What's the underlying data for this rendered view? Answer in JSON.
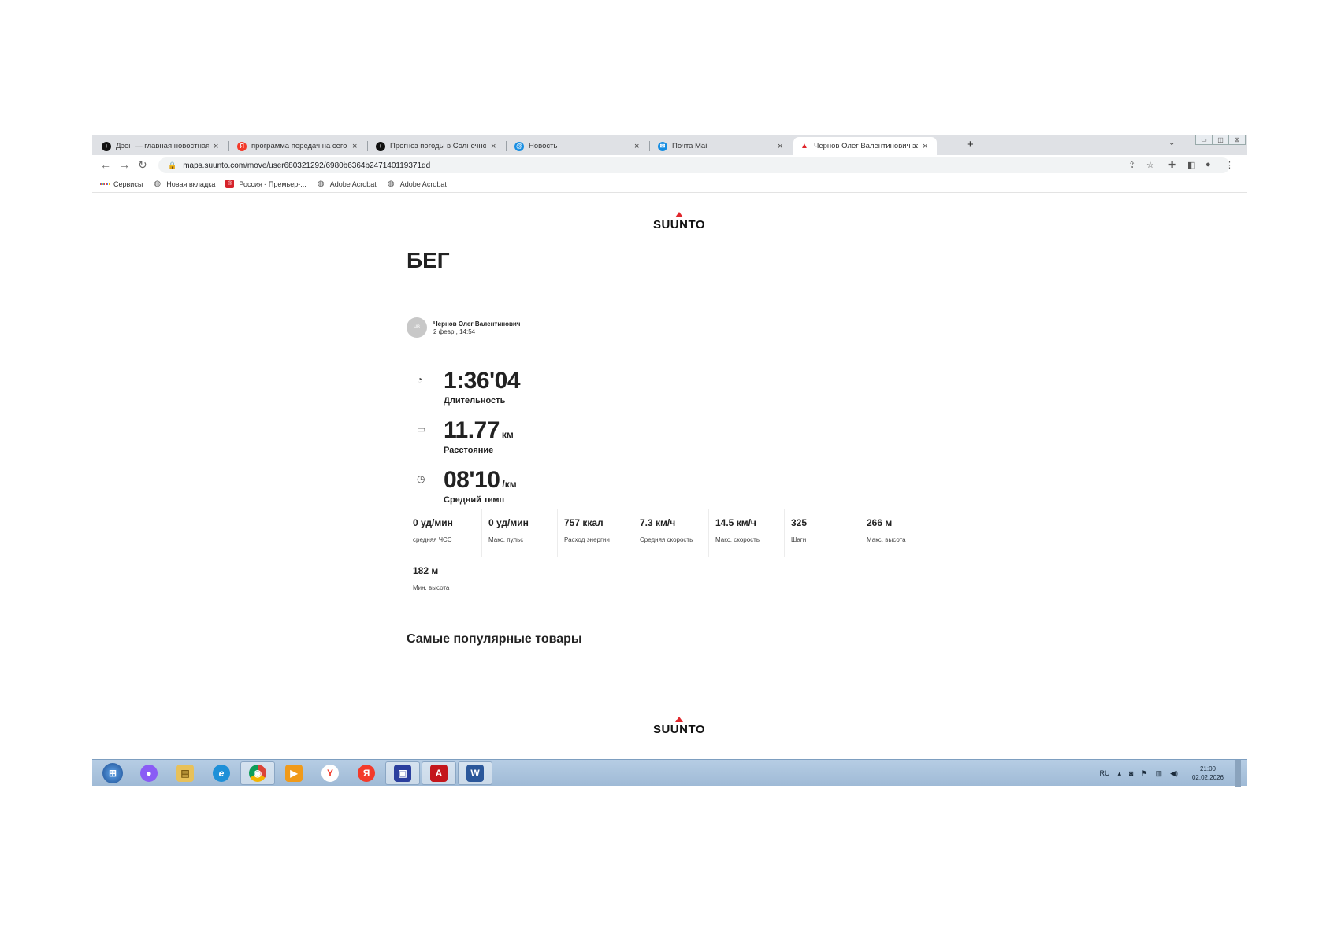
{
  "browser": {
    "tabs": [
      {
        "title": "Дзен — главная новостная инф",
        "favicon": "dzen-icon",
        "color": "#111111",
        "glyph": "+"
      },
      {
        "title": "программа передач на сегодня",
        "favicon": "yandex-icon",
        "color": "#f33a2a",
        "glyph": "Я"
      },
      {
        "title": "Прогноз погоды в Солнечногорс",
        "favicon": "dzen-icon",
        "color": "#111111",
        "glyph": "+"
      },
      {
        "title": "Новость",
        "favicon": "mail-at-icon",
        "color": "#168de2",
        "glyph": "@"
      },
      {
        "title": "Почта Mail",
        "favicon": "mail-icon",
        "color": "#168de2",
        "glyph": "✉"
      },
      {
        "title": "Чернов Олег Валентинович зан",
        "favicon": "suunto-triangle-icon",
        "color": "#e0272c",
        "glyph": "▲",
        "active": true
      }
    ],
    "close_glyph": "×",
    "new_tab_glyph": "+",
    "url": "maps.suunto.com/move/user680321292/6980b6364b247140119371dd",
    "bookmarks": [
      {
        "label": "Сервисы",
        "icon": "apps-grid-icon"
      },
      {
        "label": "Новая вкладка",
        "icon": "globe-icon"
      },
      {
        "label": "Россия - Премьер-...",
        "icon": "russia-tv-icon"
      },
      {
        "label": "Adobe Acrobat",
        "icon": "globe-icon"
      },
      {
        "label": "Adobe Acrobat",
        "icon": "globe-icon"
      }
    ]
  },
  "page": {
    "logo_text": "SUUNTO",
    "activity_title": "БЕГ",
    "user": {
      "initials": "ЧВ",
      "name": "Чернов Олег Валентинович",
      "date": "2 февр., 14:54"
    },
    "metrics": [
      {
        "value": "1:36'04",
        "unit": "",
        "label": "Длительность",
        "icon": "stopwatch-icon"
      },
      {
        "value": "11.77",
        "unit": "км",
        "label": "Расстояние",
        "icon": "ruler-icon"
      },
      {
        "value": "08'10",
        "unit": "/км",
        "label": "Средний темп",
        "icon": "speedometer-icon"
      }
    ],
    "stats": [
      {
        "value": "0 уд/мин",
        "label": "средняя ЧСС"
      },
      {
        "value": "0 уд/мин",
        "label": "Макс. пульс"
      },
      {
        "value": "757 ккал",
        "label": "Расход энергии"
      },
      {
        "value": "7.3 км/ч",
        "label": "Средняя скорость"
      },
      {
        "value": "14.5 км/ч",
        "label": "Макс. скорость"
      },
      {
        "value": "325",
        "label": "Шаги"
      },
      {
        "value": "266 м",
        "label": "Макс. высота"
      },
      {
        "value": "182 м",
        "label": "Мин. высота"
      }
    ],
    "popular_heading": "Самые популярные товары",
    "footer_logo_text": "SUUNTO"
  },
  "taskbar": {
    "apps": [
      {
        "name": "start-button",
        "icon": "windows-orb-icon",
        "color": "#2d6db5",
        "glyph": "⊞"
      },
      {
        "name": "alice-app",
        "icon": "alice-icon",
        "color": "#8a5cf5",
        "glyph": "●"
      },
      {
        "name": "explorer-app",
        "icon": "folder-icon",
        "color": "#e8c15a",
        "glyph": "▤"
      },
      {
        "name": "ie-app",
        "icon": "internet-explorer-icon",
        "color": "#1e90d8",
        "glyph": "e"
      },
      {
        "name": "chrome-app",
        "icon": "chrome-icon",
        "color": "#db4437",
        "glyph": "◉",
        "pressed": true
      },
      {
        "name": "media-app",
        "icon": "media-player-icon",
        "color": "#f09a1a",
        "glyph": "▶"
      },
      {
        "name": "yandex-browser-app",
        "icon": "yandex-browser-icon",
        "color": "#f33a2a",
        "glyph": "Y"
      },
      {
        "name": "yandex-app",
        "icon": "yandex-icon",
        "color": "#f33a2a",
        "glyph": "Я"
      },
      {
        "name": "save-app",
        "icon": "floppy-disk-icon",
        "color": "#2b3f9e",
        "glyph": "▣",
        "pressed": true
      },
      {
        "name": "acrobat-app",
        "icon": "acrobat-icon",
        "color": "#c4161c",
        "glyph": "A",
        "pressed": true
      },
      {
        "name": "word-app",
        "icon": "word-icon",
        "color": "#2b579a",
        "glyph": "W",
        "pressed": true
      }
    ],
    "lang": "RU",
    "time": "21:00",
    "date": "02.02.2026"
  }
}
